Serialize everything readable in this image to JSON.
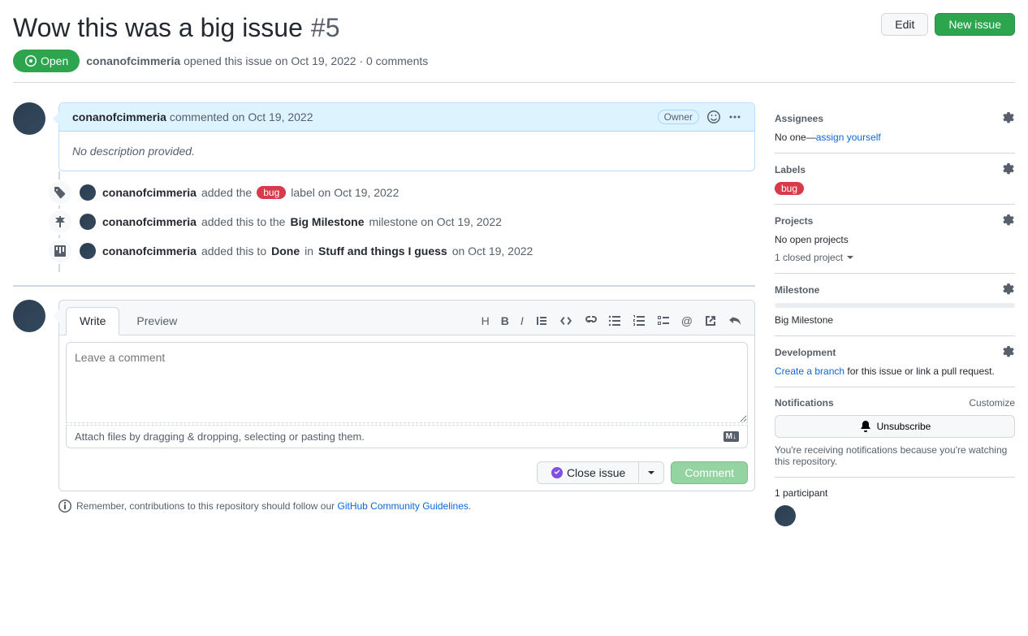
{
  "header": {
    "title": "Wow this was a big issue",
    "number": "#5",
    "edit": "Edit",
    "new_issue": "New issue"
  },
  "state": {
    "label": "Open",
    "author": "conanofcimmeria",
    "opened": " opened this issue on Oct 19, 2022 · 0 comments"
  },
  "comment": {
    "author": "conanofcimmeria",
    "action": " commented on Oct 19, 2022",
    "owner_badge": "Owner",
    "body": "No description provided."
  },
  "timeline": {
    "t1_author": "conanofcimmeria",
    "t1_a": " added the ",
    "t1_label": "bug",
    "t1_b": " label on Oct 19, 2022",
    "t2_author": "conanofcimmeria",
    "t2_a": " added this to the ",
    "t2_milestone": "Big Milestone",
    "t2_b": " milestone on Oct 19, 2022",
    "t3_author": "conanofcimmeria",
    "t3_a": " added this to ",
    "t3_done": "Done",
    "t3_in": " in ",
    "t3_proj": "Stuff and things I guess",
    "t3_b": " on Oct 19, 2022"
  },
  "form": {
    "tab_write": "Write",
    "tab_preview": "Preview",
    "placeholder": "Leave a comment",
    "attach": "Attach files by dragging & dropping, selecting or pasting them.",
    "close": "Close issue",
    "comment": "Comment",
    "md": "M↓"
  },
  "footer": {
    "prefix": "Remember, contributions to this repository should follow our ",
    "link": "GitHub Community Guidelines",
    "suffix": "."
  },
  "side": {
    "assignees": "Assignees",
    "no_one": "No one—",
    "assign_self": "assign yourself",
    "labels": "Labels",
    "bug": "bug",
    "projects": "Projects",
    "no_projects": "No open projects",
    "closed_project": "1 closed project",
    "milestone": "Milestone",
    "milestone_name": "Big Milestone",
    "development": "Development",
    "create_branch": "Create a branch",
    "dev_suffix": " for this issue or link a pull request.",
    "notifications": "Notifications",
    "customize": "Customize",
    "unsubscribe": "Unsubscribe",
    "sub_note": "You're receiving notifications because you're watching this repository.",
    "participants": "1 participant"
  }
}
